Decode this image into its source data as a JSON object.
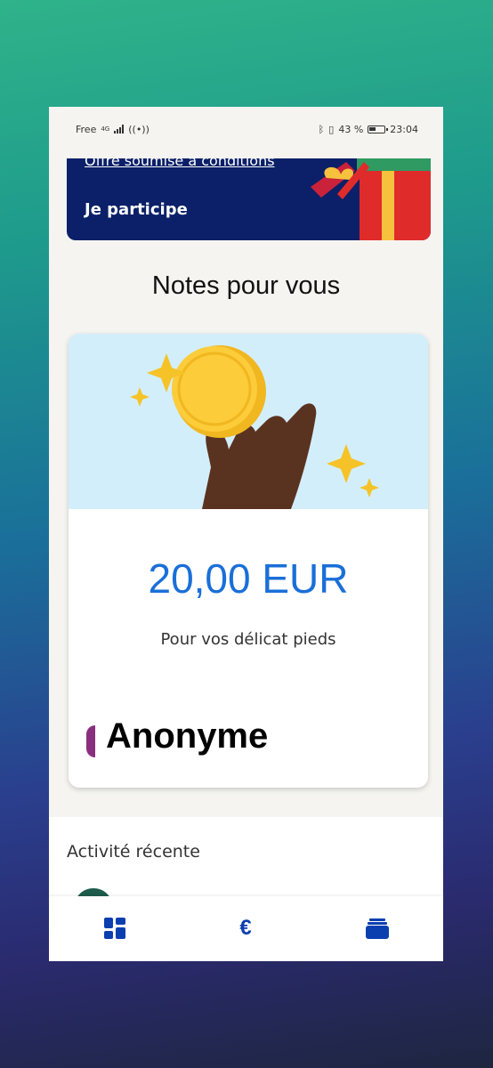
{
  "status_bar": {
    "carrier": "Free",
    "network": "4G",
    "battery_percent": "43 %",
    "time": "23:04"
  },
  "promo": {
    "terms_link": "Offre soumise à conditions",
    "cta_label": "Je participe"
  },
  "notes": {
    "title": "Notes pour vous",
    "card": {
      "amount": "20,00 EUR",
      "message": "Pour vos délicat pieds",
      "sender": "Anonyme"
    }
  },
  "recent_activity": {
    "title": "Activité récente"
  },
  "bottom_nav": {
    "items": [
      {
        "icon": "dashboard-icon"
      },
      {
        "icon": "euro-icon",
        "label": "€"
      },
      {
        "icon": "wallet-icon"
      }
    ]
  },
  "colors": {
    "promo_bg": "#0b2068",
    "amount": "#1a6fd8",
    "nav_icon": "#0b3fb0",
    "art_bg": "#d3eefb"
  }
}
